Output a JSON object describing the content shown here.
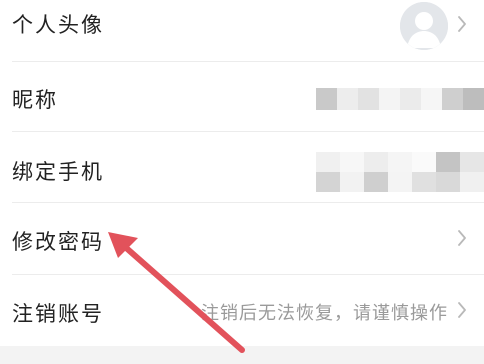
{
  "settings": {
    "rows": [
      {
        "label": "个人头像"
      },
      {
        "label": "昵称"
      },
      {
        "label": "绑定手机"
      },
      {
        "label": "修改密码"
      },
      {
        "label": "注销账号",
        "value": "注销后无法恢复，请谨慎操作"
      }
    ]
  },
  "colors": {
    "text": "#222222",
    "secondary_text": "#9a9a9a",
    "chevron": "#b9b9b9",
    "divider": "#ececec",
    "annotation_arrow": "#e2525b"
  },
  "icons": {
    "avatar": "default-user-avatar-icon",
    "chevron": "chevron-right-icon",
    "arrow": "red-annotation-arrow"
  }
}
